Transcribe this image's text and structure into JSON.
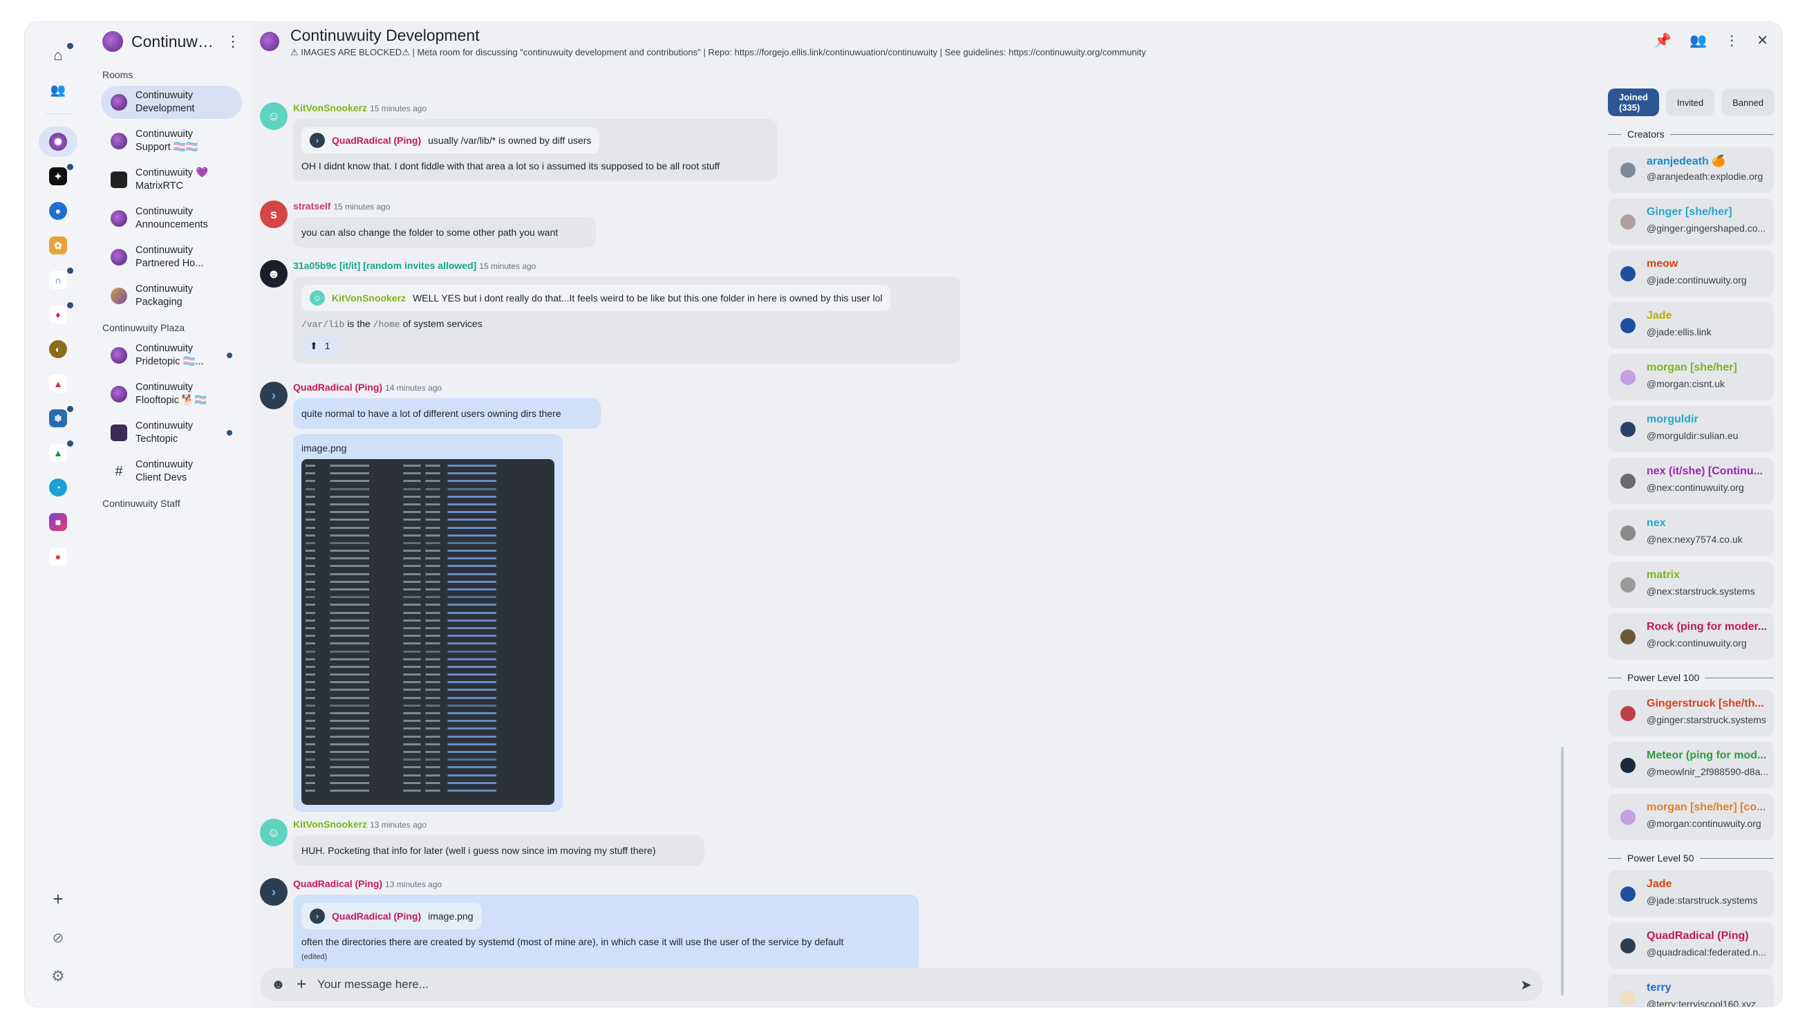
{
  "space": {
    "title": "Continuwuity",
    "menu_icon": "kebab-icon"
  },
  "rail": {
    "home_icon": "home-icon",
    "people_icon": "people-icon",
    "add_icon": "plus-icon",
    "explore_icon": "compass-icon",
    "settings_icon": "gear-icon"
  },
  "roomlist": {
    "sections": {
      "rooms": "Rooms",
      "plaza": "Continuwuity Plaza",
      "staff": "Continuwuity Staff"
    },
    "rooms": [
      {
        "name": "Continuwuity Development",
        "active": true,
        "unread": false
      },
      {
        "name": "Continuwuity Support 🏳️‍⚧️🏳️‍⚧️",
        "active": false,
        "unread": false
      },
      {
        "name": "Continuwuity 💜 MatrixRTC",
        "active": false,
        "unread": false
      },
      {
        "name": "Continuwuity Announcements",
        "active": false,
        "unread": false
      },
      {
        "name": "Continuwuity Partnered Ho...",
        "active": false,
        "unread": false
      },
      {
        "name": "Continuwuity Packaging",
        "active": false,
        "unread": false
      }
    ],
    "plaza_rooms": [
      {
        "name": "Continuwuity Pridetopic 🏳️‍⚧️...",
        "unread": true
      },
      {
        "name": "Continuwuity Flooftopic 🐕🏳️‍⚧️",
        "unread": false
      },
      {
        "name": "Continuwuity Techtopic",
        "unread": true
      },
      {
        "name": "Continuwuity Client Devs",
        "unread": false
      }
    ]
  },
  "header": {
    "title": "Continuwuity Development",
    "topic": "⚠ IMAGES ARE BLOCKED⚠ | Meta room for discussing \"continuwuity development and contributions\" | Repo: https://forgejo.ellis.link/continuwuation/continuwuity | See guidelines: https://continuwuity.org/community"
  },
  "messages": [
    {
      "sender": "KitVonSnookerz",
      "color": "#7cb518",
      "time": "15 minutes ago",
      "reply_sender": "QuadRadical (Ping)",
      "reply_text": "usually /var/lib/* is owned by diff users",
      "body": "OH I didnt know that. I dont fiddle with that area a lot so i assumed its supposed to be all root stuff"
    },
    {
      "sender": "stratself",
      "color": "#d1337a",
      "time": "15 minutes ago",
      "avatar_letter": "s",
      "body": "you can also change the folder to some other path you want"
    },
    {
      "sender": "31a05b9c [it/it] [random invites allowed]",
      "color": "#17a589",
      "time": "15 minutes ago",
      "reply_sender": "KitVonSnookerz",
      "reply_text": "WELL YES but i dont really do that...It feels weird to be like but this one folder in here is owned by this user lol",
      "code1": "/var/lib",
      "body_mid": "is the",
      "code2": "/home",
      "body_end": "of system services",
      "reaction_emoji": "⬆",
      "reaction_count": "1"
    },
    {
      "sender": "QuadRadical (Ping)",
      "color": "#c2185b",
      "time": "14 minutes ago",
      "body": "quite normal to have a lot of different users owning dirs there",
      "image_name": "image.png"
    },
    {
      "sender": "KitVonSnookerz",
      "color": "#7cb518",
      "time": "13 minutes ago",
      "body": "HUH. Pocketing that info for later (well i guess now since im moving my stuff there)"
    },
    {
      "sender": "QuadRadical (Ping)",
      "color": "#c2185b",
      "time": "13 minutes ago",
      "reply_sender": "QuadRadical (Ping)",
      "reply_text": "image.png",
      "body": "often the directories there are created by systemd (most of mine are), in which case it will use the user of the service by default",
      "edited": "(edited)"
    }
  ],
  "composer": {
    "placeholder": "Your message here..."
  },
  "members": {
    "tabs": [
      "Joined (335)",
      "Invited",
      "Banned"
    ],
    "groups": {
      "creators": "Creators",
      "pl100": "Power Level 100",
      "pl50": "Power Level 50"
    },
    "creators": [
      {
        "name": "aranjedeath 🍊",
        "id": "@aranjedeath:explodie.org",
        "color": "#1e88c7"
      },
      {
        "name": "Ginger [she/her]",
        "id": "@ginger:gingershaped.co...",
        "color": "#26a6c9"
      },
      {
        "name": "meow",
        "id": "@jade:continuwuity.org",
        "color": "#d84315"
      },
      {
        "name": "Jade",
        "id": "@jade:ellis.link",
        "color": "#b8b000"
      },
      {
        "name": "morgan [she/her]",
        "id": "@morgan:cisnt.uk",
        "color": "#7cb518"
      },
      {
        "name": "morguldir",
        "id": "@morguldir:sulian.eu",
        "color": "#26a6c9"
      },
      {
        "name": "nex (it/she) [Continu...",
        "id": "@nex:continuwuity.org",
        "color": "#9c27b0"
      },
      {
        "name": "nex",
        "id": "@nex:nexy7574.co.uk",
        "color": "#26a6c9"
      },
      {
        "name": "matrix",
        "id": "@nex:starstruck.systems",
        "color": "#7cb518"
      },
      {
        "name": "Rock (ping for moder...",
        "id": "@rock:continuwuity.org",
        "color": "#c2185b"
      }
    ],
    "pl100": [
      {
        "name": "Gingerstruck [she/th...",
        "id": "@ginger:starstruck.systems",
        "color": "#d84315"
      },
      {
        "name": "Meteor (ping for mod...",
        "id": "@meowlnir_2f988590-d8a...",
        "color": "#2e9d3a"
      },
      {
        "name": "morgan [she/her] [co...",
        "id": "@morgan:continuwuity.org",
        "color": "#e67e22"
      }
    ],
    "pl50": [
      {
        "name": "Jade",
        "id": "@jade:starstruck.systems",
        "color": "#d84315"
      },
      {
        "name": "QuadRadical (Ping)",
        "id": "@quadradical:federated.n...",
        "color": "#c2185b"
      },
      {
        "name": "terry",
        "id": "@terry:terryiscool160.xyz",
        "color": "#1e6fd0"
      }
    ]
  }
}
